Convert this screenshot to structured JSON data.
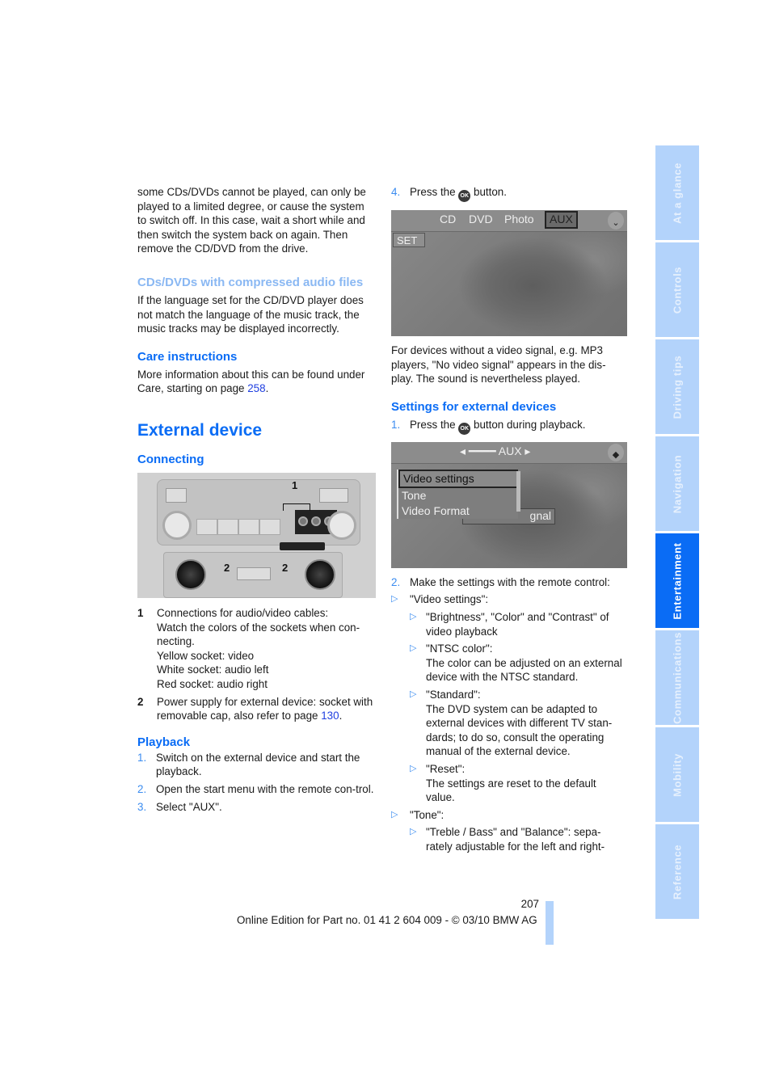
{
  "left_column": {
    "intro_paragraph": "some CDs/DVDs cannot be played, can only be played to a limited degree, or cause the system to switch off. In this case, wait a short while and then switch the system back on again. Then remove the CD/DVD from the drive.",
    "compressed_heading": "CDs/DVDs with compressed audio files",
    "compressed_text": "If the language set for the CD/DVD player does not match the language of the music track, the music tracks may be displayed incorrectly.",
    "care_heading": "Care instructions",
    "care_text_before": "More information about this can be found under Care, starting on page ",
    "care_link": "258",
    "care_text_after": ".",
    "section_title": "External device",
    "connecting_heading": "Connecting",
    "radio_figure": {
      "callout_1": "1",
      "callout_2a": "2",
      "callout_2b": "2"
    },
    "legend": [
      {
        "num": "1",
        "lines": [
          "Connections for audio/video cables:",
          "Watch the colors of the sockets when con-necting.",
          "Yellow socket: video",
          "White socket: audio left",
          "Red socket: audio right"
        ]
      },
      {
        "num": "2",
        "text_before": "Power supply for external device: socket with removable cap, also refer to page ",
        "link": "130",
        "text_after": "."
      }
    ],
    "playback_heading": "Playback",
    "playback_steps": [
      {
        "num": "1.",
        "text": "Switch on the external device and start the playback."
      },
      {
        "num": "2.",
        "text": "Open the start menu with the remote con-trol."
      },
      {
        "num": "3.",
        "text": "Select \"AUX\"."
      }
    ]
  },
  "right_column": {
    "step4_num": "4.",
    "step4_before": "Press the ",
    "step4_after": " button.",
    "ok_icon_label": "OK",
    "screen1": {
      "tabs": [
        "CD",
        "DVD",
        "Photo",
        "AUX"
      ],
      "selected_tab": "AUX",
      "set_button": "SET"
    },
    "no_video_text": "For devices without a video signal, e.g. MP3 players, \"No video signal\" appears in the dis-play. The sound is nevertheless played.",
    "settings_heading": "Settings for external devices",
    "settings_step1_num": "1.",
    "settings_step1_before": "Press the ",
    "settings_step1_after": " button during playback.",
    "screen2": {
      "title": "AUX",
      "menu_items": [
        "Video settings",
        "Tone",
        "Video Format"
      ],
      "selected_item": "Video settings",
      "background_text": "gnal"
    },
    "settings_step2_num": "2.",
    "settings_step2_text": "Make the settings with the remote control:",
    "bullets": [
      {
        "text": "\"Video settings\":",
        "sub": [
          {
            "title": "\"Brightness\", \"Color\" and \"Contrast\" of video playback",
            "desc": ""
          },
          {
            "title": "\"NTSC color\":",
            "desc": "The color can be adjusted on an external device with the NTSC standard."
          },
          {
            "title": "\"Standard\":",
            "desc": "The DVD system can be adapted to external devices with different TV stan-dards; to do so, consult the operating manual of the external device."
          },
          {
            "title": "\"Reset\":",
            "desc": "The settings are reset to the default value."
          }
        ]
      },
      {
        "text": "\"Tone\":",
        "sub": [
          {
            "title": "\"Treble / Bass\" and \"Balance\": sepa-rately adjustable for the left and right-",
            "desc": ""
          }
        ]
      }
    ]
  },
  "side_tabs": [
    {
      "label": "At a glance",
      "active": false
    },
    {
      "label": "Controls",
      "active": false
    },
    {
      "label": "Driving tips",
      "active": false
    },
    {
      "label": "Navigation",
      "active": false
    },
    {
      "label": "Entertainment",
      "active": true
    },
    {
      "label": "Communications",
      "active": false
    },
    {
      "label": "Mobility",
      "active": false
    },
    {
      "label": "Reference",
      "active": false
    }
  ],
  "footer": {
    "page_number": "207",
    "edition_text": "Online Edition for Part no. 01 41 2 604 009 - © 03/10 BMW AG"
  },
  "colors": {
    "heading_blue": "#0a6cf5",
    "light_heading_blue": "#8ab8f3",
    "tab_light_blue": "#b3d3fb",
    "link_blue": "#1f3fe0"
  }
}
